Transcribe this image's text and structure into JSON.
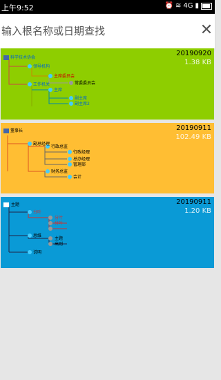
{
  "status_bar": {
    "time": "上午9:52",
    "network": "4G"
  },
  "search": {
    "placeholder": "输入根名称或日期查找"
  },
  "cards": [
    {
      "date": "20190920",
      "size": "1.38 KB",
      "bg": "#8ece00",
      "root": "科学技术协会",
      "nodes": [
        "领导机构",
        "主席委员会",
        "常委委员会",
        "工作机关",
        "主席",
        "副主席",
        "副主席2"
      ]
    },
    {
      "date": "20190911",
      "size": "102.49 KB",
      "bg": "#ffbe33",
      "root": "董事长",
      "nodes": [
        "副总经理",
        "行政总监",
        "行政经理",
        "总办经理",
        "管理部",
        "财务总监",
        "会计"
      ]
    },
    {
      "date": "20190911",
      "size": "1.20 KB",
      "bg": "#0a9ad6",
      "root": "主题",
      "nodes": [
        "分叶",
        "分叶",
        "分叶",
        "思维",
        "主题",
        "出则",
        "说明"
      ]
    }
  ]
}
